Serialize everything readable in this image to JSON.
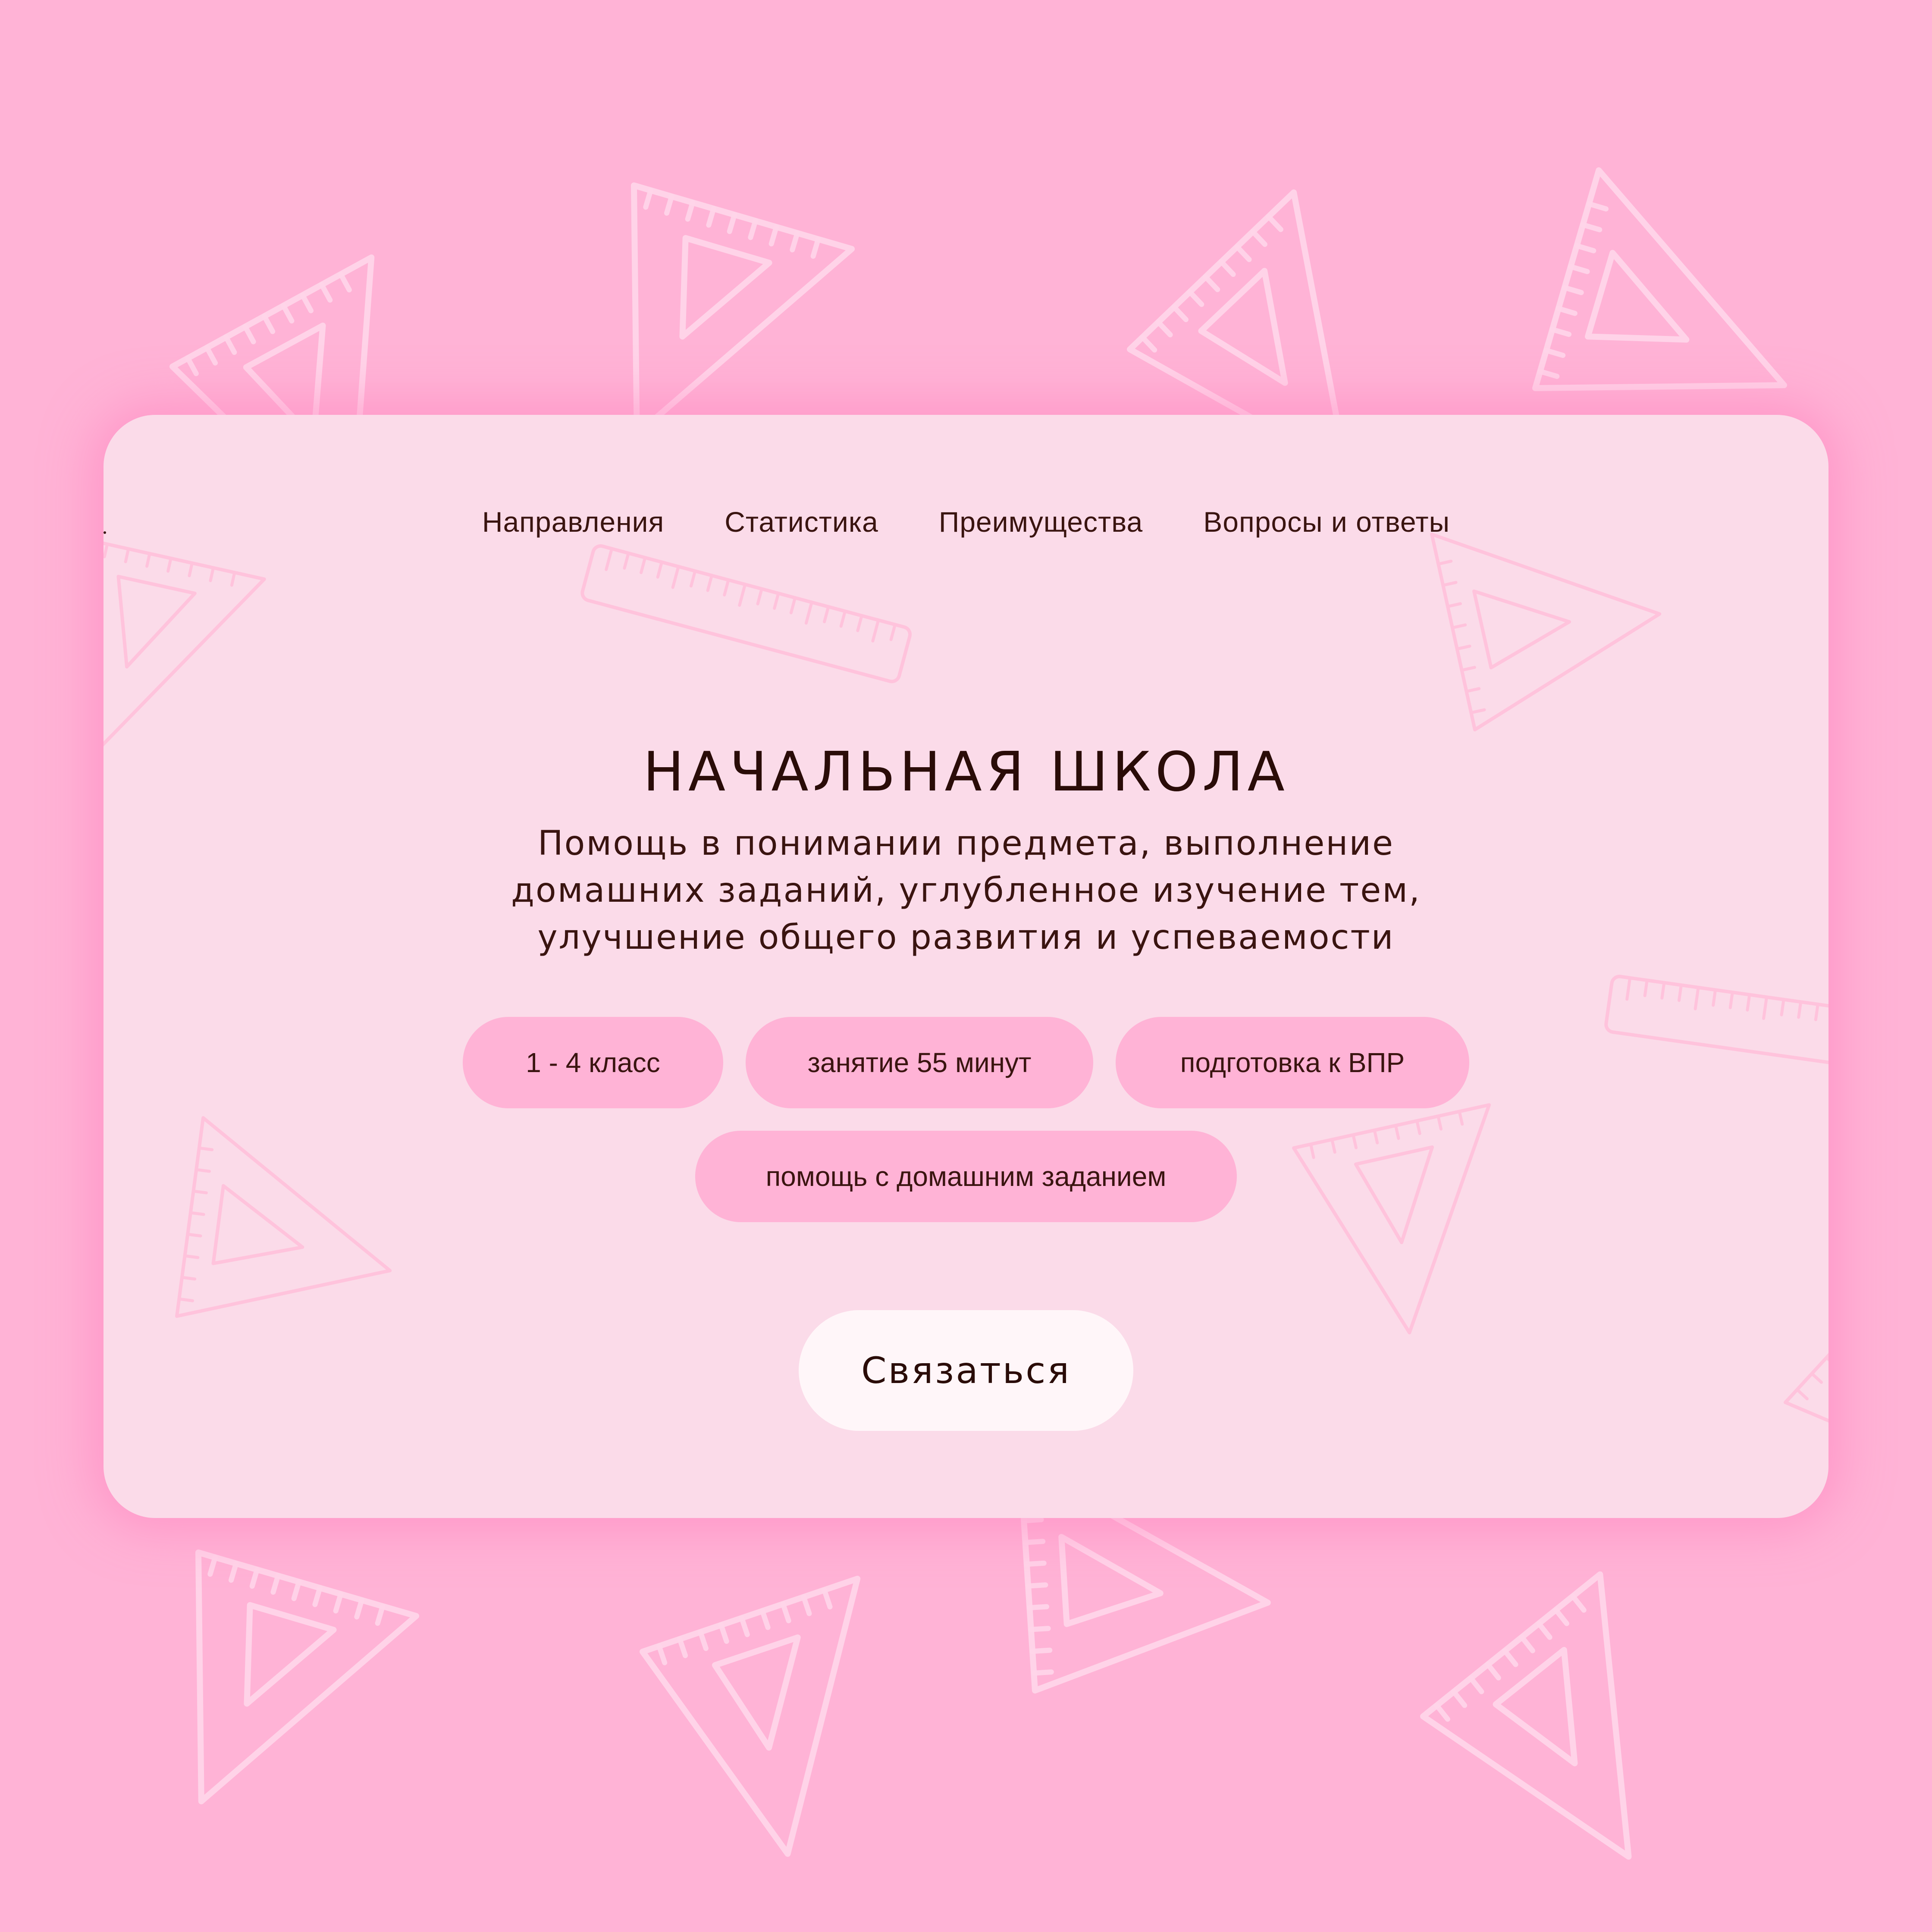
{
  "nav": {
    "items": [
      {
        "label": "Направления"
      },
      {
        "label": "Статистика"
      },
      {
        "label": "Преимущества"
      },
      {
        "label": "Вопросы и ответы"
      }
    ]
  },
  "hero": {
    "title": "НАЧАЛЬНАЯ ШКОЛА",
    "subtitle_lines": [
      "Помощь в понимании предмета, выполнение",
      "домашних заданий, углубленное изучение тем,",
      "улучшение общего развития и успеваемости"
    ],
    "tags": [
      {
        "label": "1 - 4 класс"
      },
      {
        "label": "занятие 55 минут"
      },
      {
        "label": "подготовка к ВПР"
      },
      {
        "label": "помощь с домашним заданием"
      }
    ],
    "cta_label": "Связаться"
  },
  "colors": {
    "page_background": "#ffb3d6",
    "card_background": "#fbdbe9",
    "tag_background": "#ffb3d6",
    "button_background": "#fff6f9",
    "text_dark": "#2a0c08",
    "decor_stroke": "#ffe4f0"
  },
  "icons": {
    "background_pattern": "set-square-triangle-ruler-icon",
    "card_pattern": "ruler-and-set-square-icon"
  }
}
